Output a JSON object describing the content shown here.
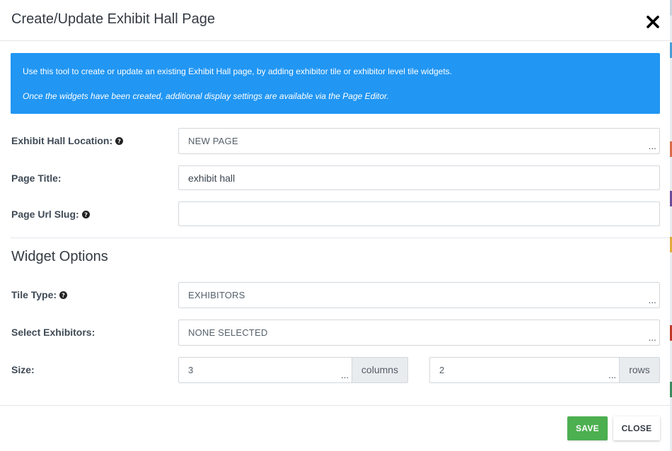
{
  "modal": {
    "title": "Create/Update Exhibit Hall Page",
    "close_icon": "close-x-icon"
  },
  "info": {
    "line1": "Use this tool to create or update an existing Exhibit Hall page, by adding exhibitor tile or exhibitor level tile widgets.",
    "line2": "Once the widgets have been created, additional display settings are available via the Page Editor.",
    "background": "#2196f3"
  },
  "form": {
    "location": {
      "label": "Exhibit Hall Location:",
      "value": "NEW PAGE",
      "ellipsis": "..."
    },
    "page_title": {
      "label": "Page Title:",
      "value": "exhibit hall"
    },
    "url_slug": {
      "label": "Page Url Slug:",
      "value": ""
    }
  },
  "widget_options": {
    "heading": "Widget Options",
    "tile_type": {
      "label": "Tile Type:",
      "value": "EXHIBITORS",
      "ellipsis": "..."
    },
    "select_exhibitors": {
      "label": "Select Exhibitors:",
      "value": "NONE SELECTED",
      "ellipsis": "..."
    },
    "size": {
      "label": "Size:",
      "columns_value": "3",
      "columns_addon": "columns",
      "rows_value": "2",
      "rows_addon": "rows",
      "ellipsis": "..."
    }
  },
  "footer": {
    "save_label": "SAVE",
    "close_label": "CLOSE"
  },
  "colors": {
    "save_button": "#4caf50",
    "info_box": "#2196f3"
  }
}
